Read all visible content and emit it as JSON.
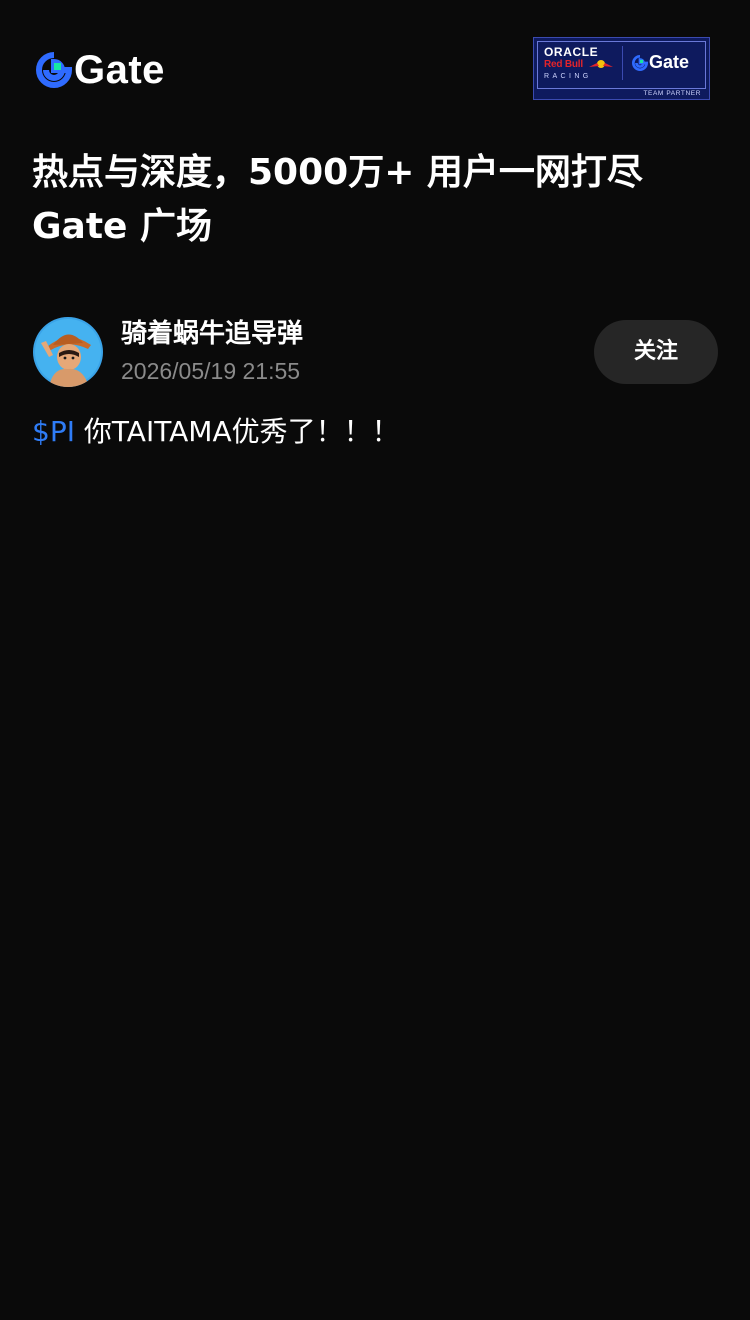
{
  "header": {
    "brand_text": "Gate",
    "partner": {
      "line1": "ORACLE",
      "line2": "Red Bull",
      "line3": "RACING",
      "gate_text": "Gate",
      "tag": "TEAM PARTNER"
    }
  },
  "headline": {
    "line1": "热点与深度，5000万+ 用户一网打尽",
    "line2": "Gate 广场"
  },
  "post": {
    "author": "骑着蜗牛追导弹",
    "timestamp": "2026/05/19 21:55",
    "follow_label": "关注",
    "ticker": "$PI",
    "text": " 你TAITAMA优秀了！！！"
  },
  "colors": {
    "background": "#0a0a0a",
    "accent_blue": "#2f7cf6",
    "logo_green": "#17e6a1",
    "follow_bg": "#262626",
    "muted_text": "#8a8a8a"
  }
}
